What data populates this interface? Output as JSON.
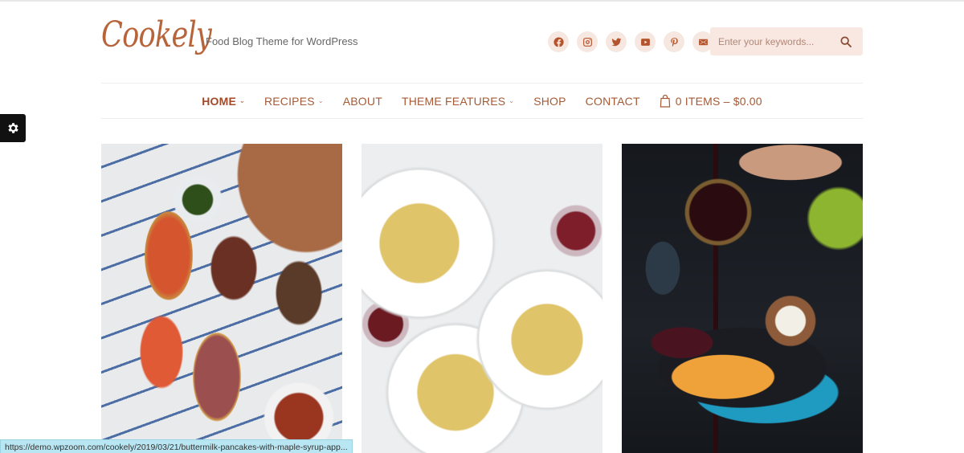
{
  "site": {
    "logo": "Cookely",
    "tagline": "Food Blog Theme for WordPress"
  },
  "social": [
    {
      "name": "facebook-icon",
      "label": "Facebook"
    },
    {
      "name": "instagram-icon",
      "label": "Instagram"
    },
    {
      "name": "twitter-icon",
      "label": "Twitter"
    },
    {
      "name": "youtube-icon",
      "label": "YouTube"
    },
    {
      "name": "pinterest-icon",
      "label": "Pinterest"
    },
    {
      "name": "email-icon",
      "label": "Email"
    }
  ],
  "search": {
    "placeholder": "Enter your keywords...",
    "value": ""
  },
  "nav": {
    "items": [
      {
        "label": "HOME",
        "has_dropdown": true,
        "active": true
      },
      {
        "label": "RECIPES",
        "has_dropdown": true,
        "active": false
      },
      {
        "label": "ABOUT",
        "has_dropdown": false,
        "active": false
      },
      {
        "label": "THEME FEATURES",
        "has_dropdown": true,
        "active": false
      },
      {
        "label": "SHOP",
        "has_dropdown": false,
        "active": false
      },
      {
        "label": "CONTACT",
        "has_dropdown": false,
        "active": false
      }
    ],
    "cart_label": "0 ITEMS – $0.00",
    "chevron": "⌄"
  },
  "posts": [
    {
      "image_alt": "Bruschetta appetizers with tomato, steak, mushrooms and beef tartare"
    },
    {
      "image_alt": "Spaghetti carbonara plates with red wine"
    },
    {
      "image_alt": "Pancakes with maple syrup being poured"
    }
  ],
  "status_bar": {
    "url": "https://demo.wpzoom.com/cookely/2019/03/21/buttermilk-pancakes-with-maple-syrup-app..."
  },
  "colors": {
    "accent": "#b5542c",
    "nav_text": "#a55a35",
    "social_bg": "#f6e8e1",
    "search_bg": "#f8e8e1"
  }
}
